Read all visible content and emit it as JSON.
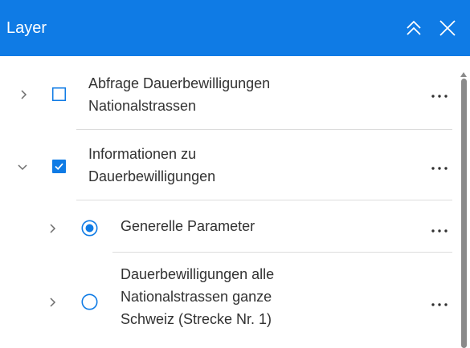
{
  "panel": {
    "title": "Layer"
  },
  "layers": [
    {
      "lines": [
        "Abfrage Dauerbewilligungen",
        "Nationalstrassen"
      ],
      "control": "checkbox",
      "checked": false,
      "expanded": false
    },
    {
      "lines": [
        "Informationen zu",
        "Dauerbewilligungen"
      ],
      "control": "checkbox",
      "checked": true,
      "expanded": true
    },
    {
      "lines": [
        "Generelle Parameter"
      ],
      "control": "radio",
      "checked": true,
      "expanded": false
    },
    {
      "lines": [
        "Dauerbewilligungen alle",
        "Nationalstrassen ganze",
        "Schweiz (Strecke Nr. 1)"
      ],
      "control": "radio",
      "checked": false,
      "expanded": false
    }
  ],
  "colors": {
    "header": "#0f7be5",
    "accent": "#0f7be5",
    "divider": "#dcdcdc",
    "text": "#323232"
  }
}
